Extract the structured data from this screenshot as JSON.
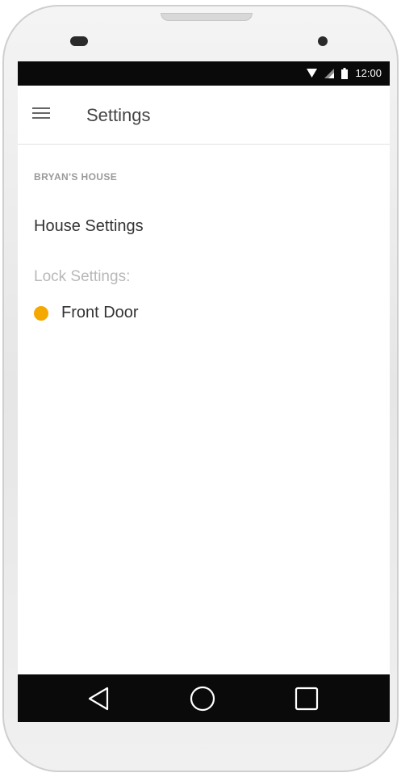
{
  "status_bar": {
    "time": "12:00",
    "icons": [
      "wifi-icon",
      "signal-icon",
      "battery-icon"
    ]
  },
  "app_bar": {
    "title": "Settings",
    "menu_icon": "hamburger-menu-icon"
  },
  "content": {
    "section_header": "BRYAN'S HOUSE",
    "house_settings_label": "House Settings",
    "lock_settings_label": "Lock Settings:",
    "locks": [
      {
        "name": "Front Door",
        "status_color": "#f5a800"
      }
    ]
  },
  "nav_bar": {
    "buttons": [
      "back-icon",
      "home-icon",
      "recents-icon"
    ]
  },
  "colors": {
    "accent": "#f5a800",
    "status_bar_bg": "#0a0a0a",
    "nav_bar_bg": "#0a0a0a"
  }
}
